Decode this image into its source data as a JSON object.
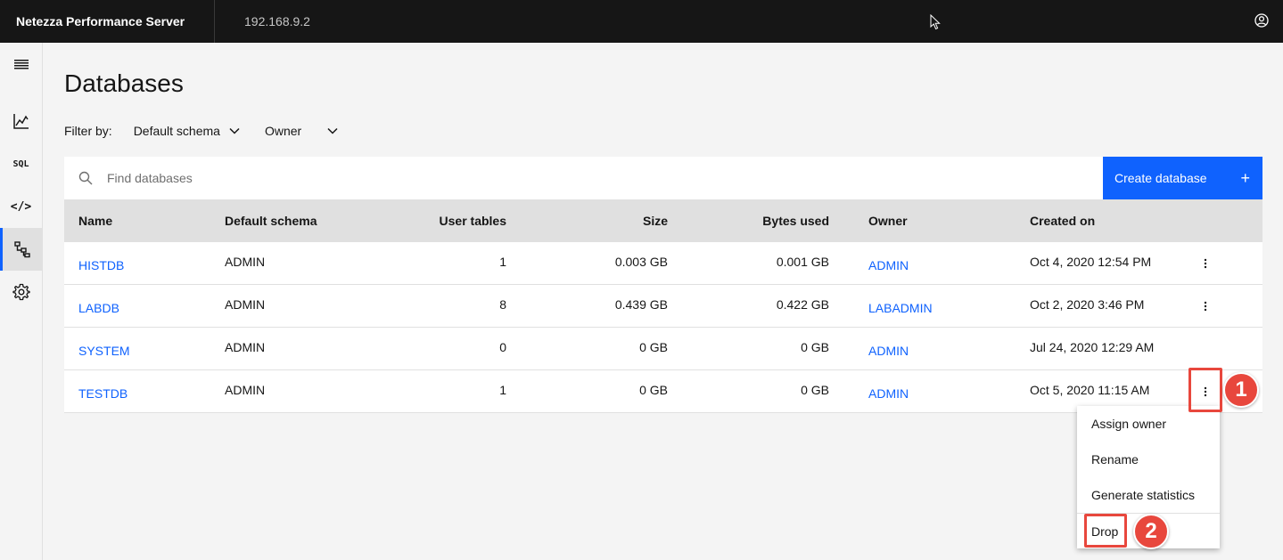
{
  "header": {
    "app_title": "Netezza Performance Server",
    "host": "192.168.9.2"
  },
  "sidebar": {
    "items": [
      {
        "name": "menu-icon"
      },
      {
        "name": "monitoring-icon"
      },
      {
        "name": "sql-icon",
        "label": "SQL"
      },
      {
        "name": "code-icon",
        "label": "</>"
      },
      {
        "name": "data-objects-icon",
        "active": true
      },
      {
        "name": "settings-icon"
      }
    ]
  },
  "page": {
    "title": "Databases",
    "filter_label": "Filter by:",
    "filters": [
      "Default schema",
      "Owner"
    ]
  },
  "toolbar": {
    "search_placeholder": "Find databases",
    "create_label": "Create database",
    "create_icon": "+"
  },
  "table": {
    "columns": [
      "Name",
      "Default schema",
      "User tables",
      "Size",
      "Bytes used",
      "Owner",
      "Created on"
    ],
    "rows": [
      {
        "name": "HISTDB",
        "schema": "ADMIN",
        "tables": "1",
        "size": "0.003 GB",
        "bytes": "0.001 GB",
        "owner": "ADMIN",
        "created": "Oct 4, 2020 12:54 PM",
        "menu": true
      },
      {
        "name": "LABDB",
        "schema": "ADMIN",
        "tables": "8",
        "size": "0.439 GB",
        "bytes": "0.422 GB",
        "owner": "LABADMIN",
        "created": "Oct 2, 2020 3:46 PM",
        "menu": true
      },
      {
        "name": "SYSTEM",
        "schema": "ADMIN",
        "tables": "0",
        "size": "0 GB",
        "bytes": "0 GB",
        "owner": "ADMIN",
        "created": "Jul 24, 2020 12:29 AM",
        "menu": false
      },
      {
        "name": "TESTDB",
        "schema": "ADMIN",
        "tables": "1",
        "size": "0 GB",
        "bytes": "0 GB",
        "owner": "ADMIN",
        "created": "Oct 5, 2020 11:15 AM",
        "menu": true
      }
    ]
  },
  "context_menu": {
    "items": [
      "Assign owner",
      "Rename",
      "Generate statistics",
      "Drop"
    ]
  },
  "callouts": {
    "one": "1",
    "two": "2",
    "color": "#e8473d"
  },
  "colors": {
    "accent": "#0f62fe",
    "topbar": "#161616"
  }
}
